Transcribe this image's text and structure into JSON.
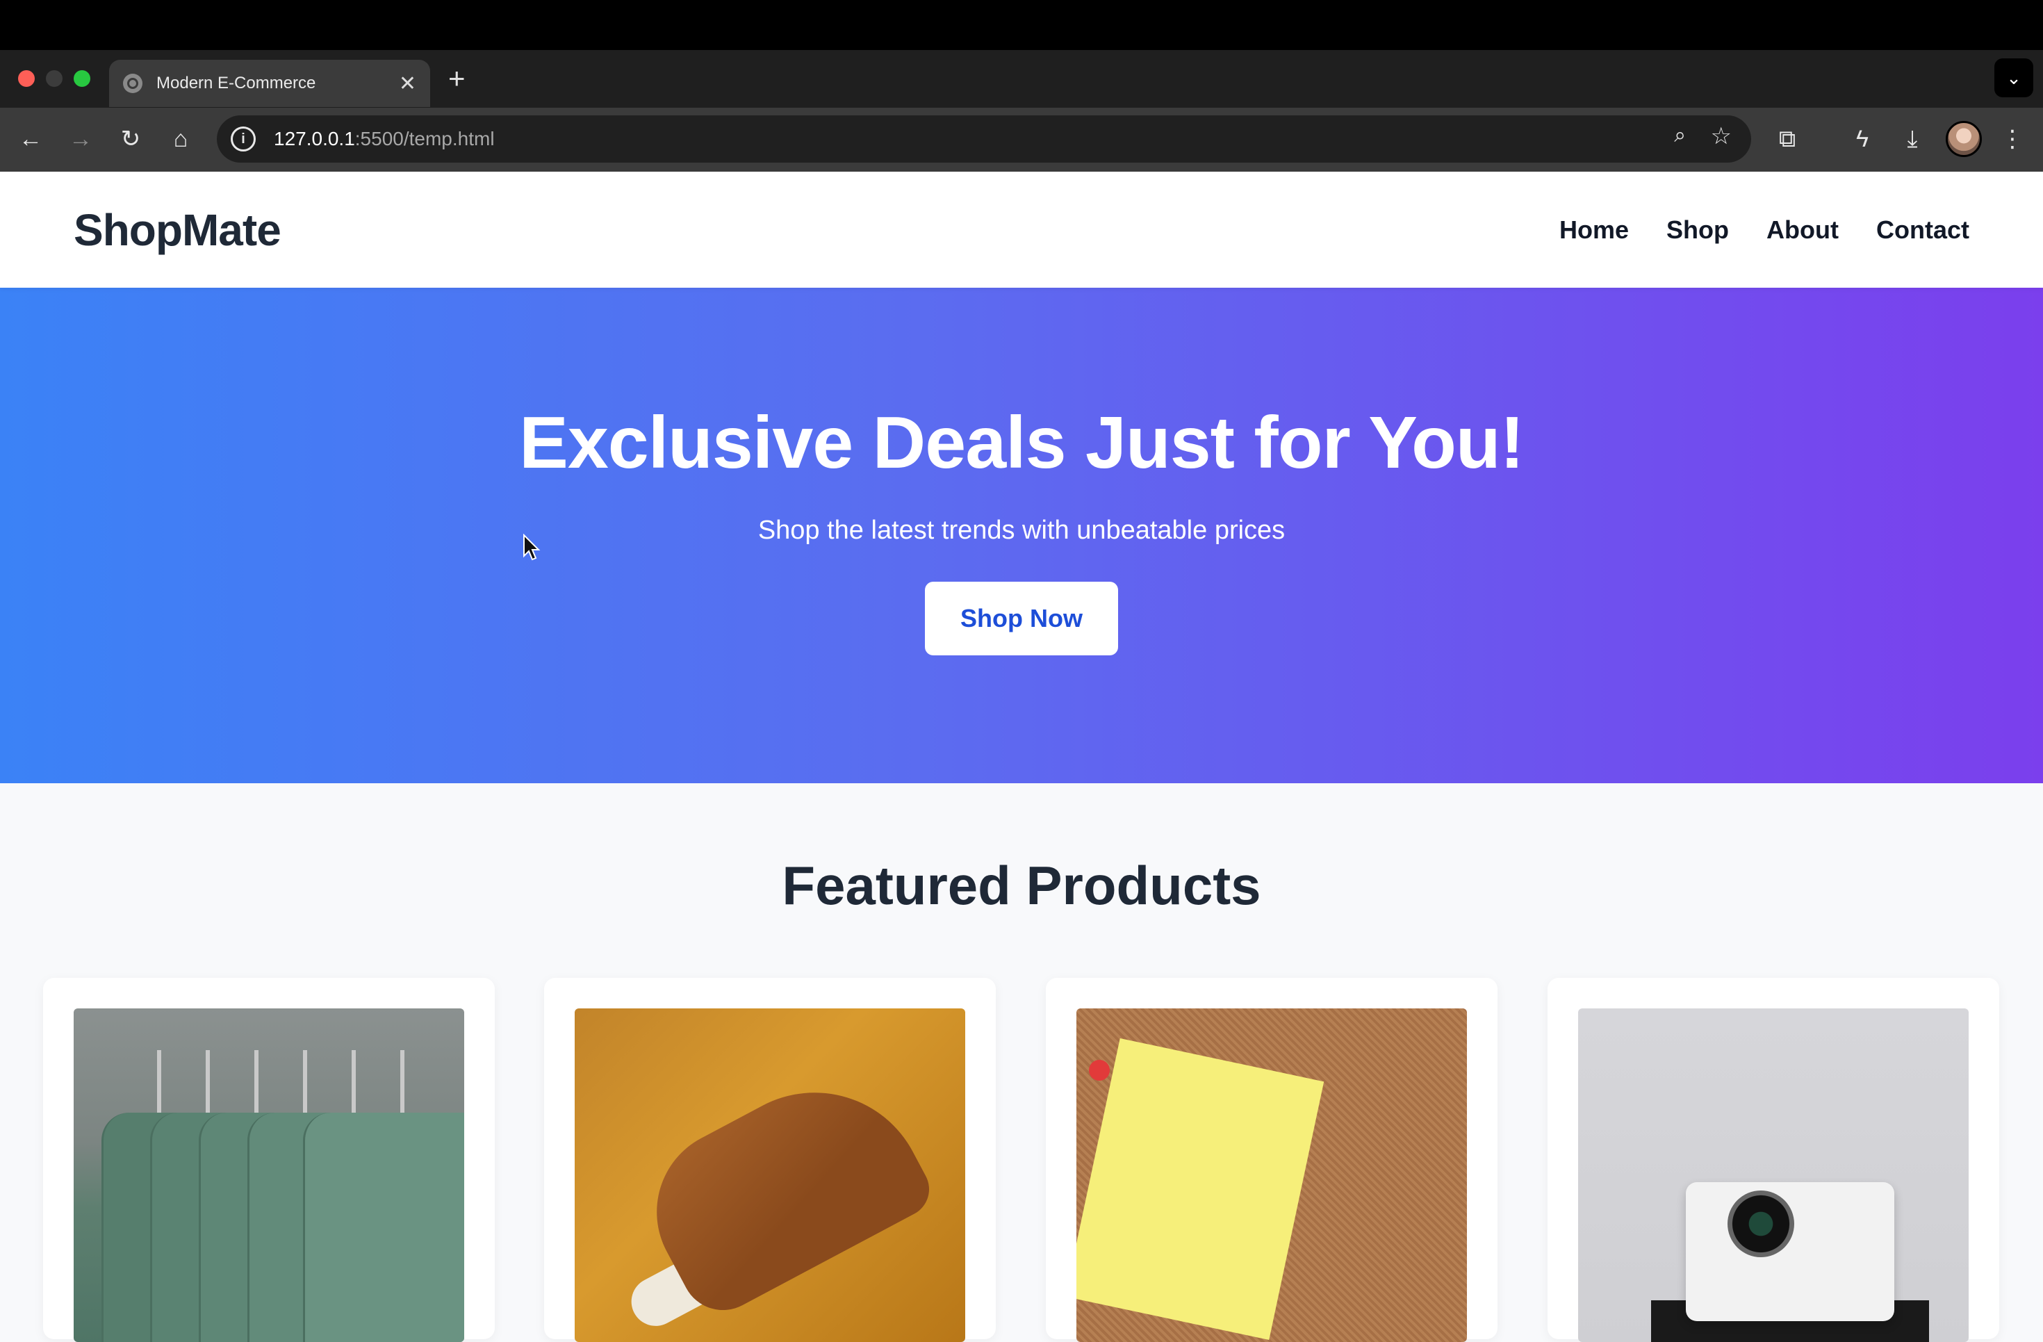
{
  "browser": {
    "tab_title": "Modern E-Commerce",
    "url_host": "127.0.0.1",
    "url_rest": ":5500/temp.html"
  },
  "site": {
    "logo": "ShopMate",
    "nav": [
      "Home",
      "Shop",
      "About",
      "Contact"
    ]
  },
  "hero": {
    "title": "Exclusive Deals Just for You!",
    "subtitle": "Shop the latest trends with unbeatable prices",
    "cta": "Shop Now"
  },
  "featured": {
    "title": "Featured Products"
  },
  "colors": {
    "hero_gradient_start": "#3b82f6",
    "hero_gradient_end": "#7b3fed",
    "cta_text": "#1d4ed8",
    "heading": "#1f2937"
  }
}
